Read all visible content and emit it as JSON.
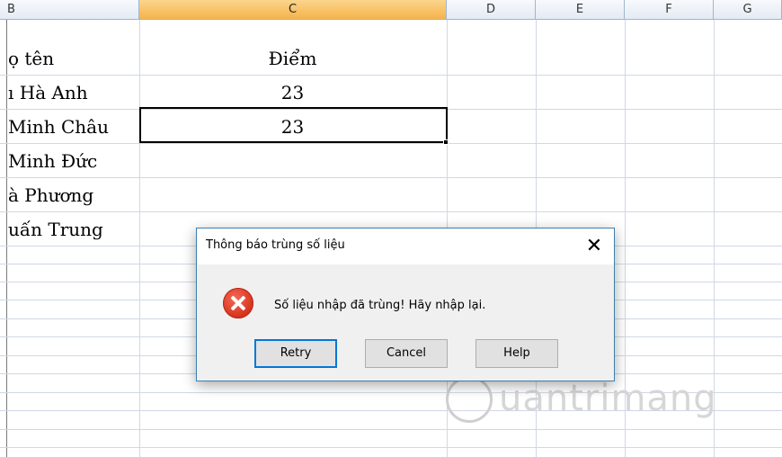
{
  "spreadsheet": {
    "columns": [
      {
        "label": "B"
      },
      {
        "label": "C"
      },
      {
        "label": "D"
      },
      {
        "label": "E"
      },
      {
        "label": "F"
      },
      {
        "label": "G"
      }
    ],
    "active_column": "C",
    "rows": [
      {
        "name": "ọ tên",
        "score": "Điểm"
      },
      {
        "name": "ı Hà Anh",
        "score": "23"
      },
      {
        "name": "Minh Châu",
        "score": "23"
      },
      {
        "name": "Minh Đức",
        "score": ""
      },
      {
        "name": "à Phương",
        "score": ""
      },
      {
        "name": "uấn Trung",
        "score": ""
      }
    ]
  },
  "dialog": {
    "title": "Thông báo trùng số liệu",
    "close_glyph": "✕",
    "icon": "error-icon",
    "message": "Số liệu nhập đã trùng! Hãy nhập lại.",
    "buttons": {
      "retry": "Retry",
      "cancel": "Cancel",
      "help": "Help"
    }
  },
  "watermark": {
    "text": "uantrimang"
  },
  "colors": {
    "active_header": "#f6b34a",
    "dialog_border": "#3c7fb1",
    "default_button_border": "#0078d7",
    "error_red": "#d5321d"
  }
}
